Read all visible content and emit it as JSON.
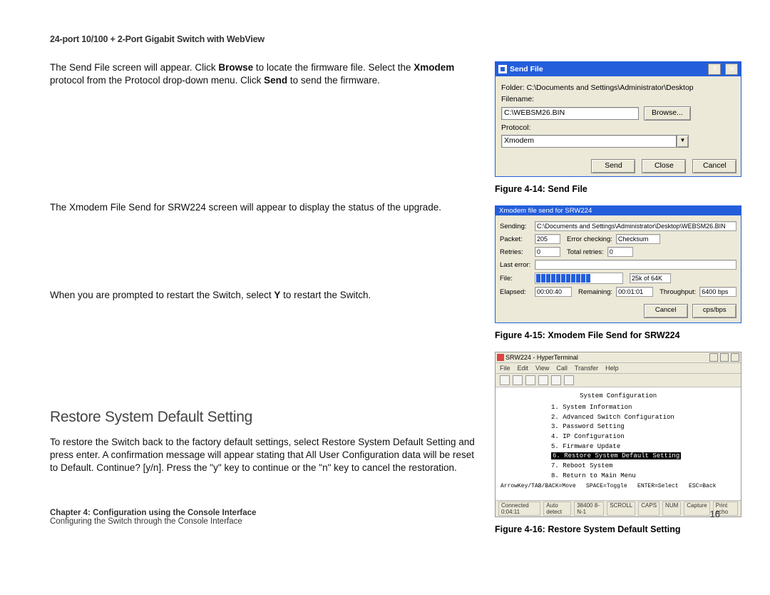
{
  "header": "24-port 10/100 + 2-Port Gigabit Switch with WebView",
  "paragraphs": {
    "p1_a": "The Send File screen will appear. Click ",
    "p1_b1": "Browse",
    "p1_c": " to locate the firmware file. Select the ",
    "p1_b2": "Xmodem",
    "p1_d": " protocol from the Protocol drop-down menu. Click ",
    "p1_b3": "Send",
    "p1_e": " to send the firmware.",
    "p2": "The Xmodem File Send for SRW224 screen will appear to display the status of the upgrade.",
    "p3_a": "When you are prompted to restart the Switch, select ",
    "p3_b": "Y",
    "p3_c": " to restart the Switch.",
    "section_title": "Restore System Default Setting",
    "p4": "To restore the Switch back to the factory default settings, select Restore System Default Setting and press enter. A confirmation message will appear stating that All User Configuration data will be reset to Default. Continue? [y/n]. Press the \"y\" key to continue or the \"n\" key to cancel the restoration."
  },
  "fig14": {
    "caption": "Figure 4-14: Send File",
    "title": "Send File",
    "folder_label": "Folder:",
    "folder_value": "C:\\Documents and Settings\\Administrator\\Desktop",
    "filename_label": "Filename:",
    "filename_value": "C:\\WEBSM26.BIN",
    "browse": "Browse...",
    "protocol_label": "Protocol:",
    "protocol_value": "Xmodem",
    "send": "Send",
    "close": "Close",
    "cancel": "Cancel",
    "help": "?",
    "x": "×"
  },
  "fig15": {
    "caption": "Figure 4-15: Xmodem File Send for SRW224",
    "title": "Xmodem file send for SRW224",
    "labels": {
      "sending": "Sending:",
      "packet": "Packet:",
      "errchk": "Error checking:",
      "retries": "Retries:",
      "totalretries": "Total retries:",
      "lasterr": "Last error:",
      "file": "File:",
      "elapsed": "Elapsed:",
      "remaining": "Remaining:",
      "throughput": "Throughput:"
    },
    "values": {
      "sending": "C:\\Documents and Settings\\Administrator\\Desktop\\WEBSM26.BIN",
      "packet": "205",
      "errchk": "Checksum",
      "retries": "0",
      "totalretries": "0",
      "lasterr": "",
      "fileprog": "25k of 64K",
      "elapsed": "00:00:40",
      "remaining": "00:01:01",
      "throughput": "6400 bps"
    },
    "cancel": "Cancel",
    "cps": "cps/bps"
  },
  "fig16": {
    "caption": "Figure 4-16: Restore System Default Setting",
    "app_title": "SRW224 - HyperTerminal",
    "menus": [
      "File",
      "Edit",
      "View",
      "Call",
      "Transfer",
      "Help"
    ],
    "screen_title": "System Configuration",
    "items": [
      "1. System Information",
      "2. Advanced Switch Configuration",
      "3. Password Setting",
      "4. IP Configuration",
      "5. Firmware Update",
      "6. Restore System Default Setting",
      "7. Reboot System",
      "8. Return to Main Menu"
    ],
    "hint": "ArrowKey/TAB/BACK=Move   SPACE=Toggle   ENTER=Select   ESC=Back",
    "status": [
      "Connected 0:04:11",
      "Auto detect",
      "38400 8-N-1",
      "SCROLL",
      "CAPS",
      "NUM",
      "Capture",
      "Print echo"
    ]
  },
  "footer": {
    "line1": "Chapter 4: Configuration using the Console Interface",
    "line2": "Configuring the Switch through the Console Interface",
    "page": "16"
  }
}
